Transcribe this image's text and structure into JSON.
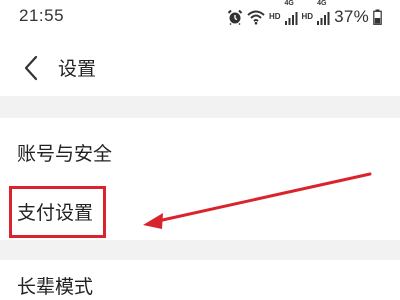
{
  "status_bar": {
    "time": "21:55",
    "icons": [
      "alarm-icon",
      "wifi-icon",
      "signal-icon",
      "signal-icon",
      "battery-icon"
    ],
    "hd_label": "HD",
    "net_label": "4G",
    "battery": "37%"
  },
  "header": {
    "back_icon": "chevron-left-icon",
    "title": "设置"
  },
  "settings": {
    "items": [
      {
        "label": "账号与安全"
      },
      {
        "label": "支付设置"
      },
      {
        "label": "长辈模式"
      }
    ]
  },
  "annotation": {
    "color": "#d9232d",
    "target": "支付设置"
  }
}
